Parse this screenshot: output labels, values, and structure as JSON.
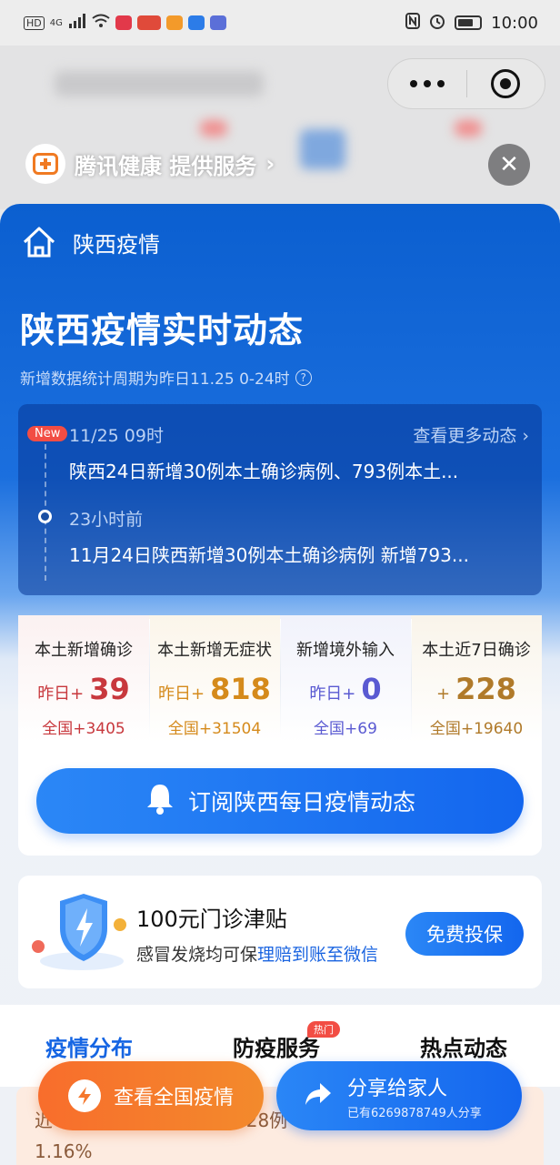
{
  "status_bar": {
    "left_labels": [
      "HD",
      "4G"
    ],
    "time": "10:00"
  },
  "provider": {
    "text": "腾讯健康 提供服务",
    "chevron": "›",
    "close": "✕"
  },
  "header": {
    "nav_title": "陕西疫情",
    "headline": "陕西疫情实时动态",
    "subnote": "新增数据统计周期为昨日11.25 0-24时",
    "subnote_icon": "?"
  },
  "timeline": {
    "new_badge": "New",
    "more": "查看更多动态 ›",
    "items": [
      {
        "time": "11/25 09时",
        "text": "陕西24日新增30例本土确诊病例、793例本土..."
      },
      {
        "time": "23小时前",
        "text": "11月24日陕西新增30例本土确诊病例 新增793..."
      }
    ]
  },
  "stats": [
    {
      "label": "本土新增确诊",
      "prefix": "昨日+",
      "value": "39",
      "sub": "全国+3405",
      "color": "#c8383d"
    },
    {
      "label": "本土新增无症状",
      "prefix": "昨日+",
      "value": "818",
      "sub": "全国+31504",
      "color": "#d58a1b"
    },
    {
      "label": "新增境外输入",
      "prefix": "昨日+",
      "value": "0",
      "sub": "全国+69",
      "color": "#5a5ad2"
    },
    {
      "label": "本土近7日确诊",
      "prefix": "+",
      "value": "228",
      "sub": "全国+19640",
      "color": "#b07a2a"
    }
  ],
  "subscribe_label": "订阅陕西每日疫情动态",
  "insurance": {
    "title": "100元门诊津贴",
    "desc_plain": "感冒发烧均可保",
    "desc_highlight": "理赔到账至微信",
    "button": "免费投保"
  },
  "tabs": [
    {
      "label": "疫情分布"
    },
    {
      "label": "防疫服务"
    },
    {
      "label": "热点动态"
    }
  ],
  "hot_badge": "热门",
  "summary_text": "近一周陕西本土累计确诊228例（不含无症状），占全国1.16%",
  "fab_national": "查看全国疫情",
  "fab_share": {
    "title": "分享给家人",
    "sub": "已有6269878749人分享"
  },
  "colors": {
    "brand_blue": "#1366ee",
    "accent_orange": "#f86d2c",
    "badge_red": "#f24d44"
  }
}
